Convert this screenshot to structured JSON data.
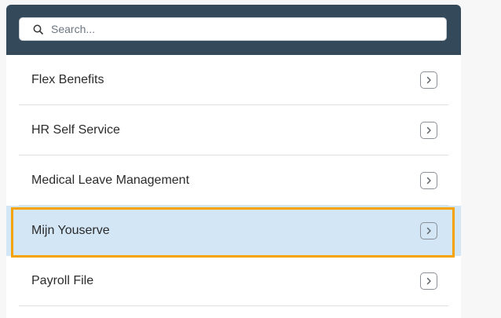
{
  "search": {
    "placeholder": "Search..."
  },
  "list": {
    "items": [
      {
        "label": "Flex Benefits"
      },
      {
        "label": "HR Self Service"
      },
      {
        "label": "Medical Leave Management"
      },
      {
        "label": "Mijn Youserve"
      },
      {
        "label": "Payroll File"
      }
    ],
    "selected_index": 3
  },
  "colors": {
    "header": "#34495a",
    "selected_bg": "#d3e6f6",
    "highlight": "#f5a300",
    "divider": "#dcdfe2"
  }
}
